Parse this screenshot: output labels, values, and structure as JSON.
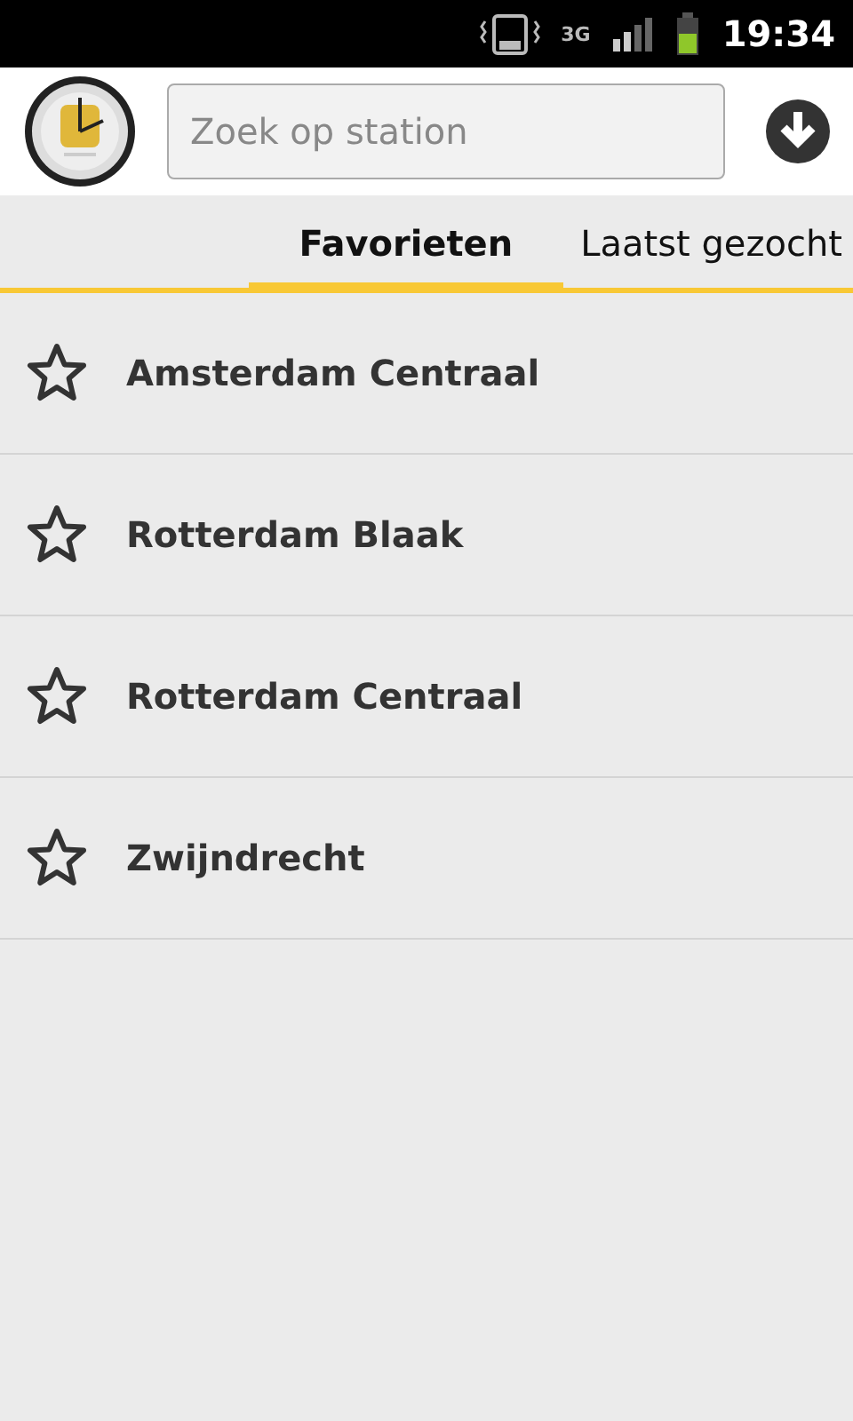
{
  "status_bar": {
    "time": "19:34",
    "network": "3G"
  },
  "search": {
    "placeholder": "Zoek op station"
  },
  "tabs": [
    {
      "label": "Favorieten",
      "selected": true
    },
    {
      "label": "Laatst gezocht",
      "selected": false
    }
  ],
  "stations": [
    {
      "name": "Amsterdam Centraal"
    },
    {
      "name": "Rotterdam Blaak"
    },
    {
      "name": "Rotterdam Centraal"
    },
    {
      "name": "Zwijndrecht"
    }
  ]
}
